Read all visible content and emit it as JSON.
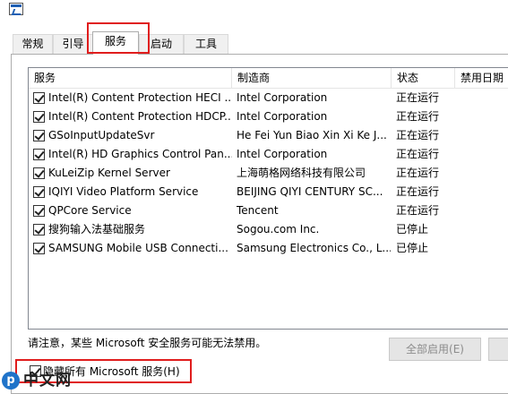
{
  "tabs": [
    {
      "label": "常规"
    },
    {
      "label": "引导"
    },
    {
      "label": "服务"
    },
    {
      "label": "启动"
    },
    {
      "label": "工具"
    }
  ],
  "active_tab": "服务",
  "columns": [
    "服务",
    "制造商",
    "状态",
    "禁用日期"
  ],
  "services": [
    {
      "name": "Intel(R) Content Protection HECI ...",
      "maker": "Intel Corporation",
      "status": "正在运行",
      "checked": true
    },
    {
      "name": "Intel(R) Content Protection HDCP...",
      "maker": "Intel Corporation",
      "status": "正在运行",
      "checked": true
    },
    {
      "name": "GSoInputUpdateSvr",
      "maker": "He Fei Yun Biao Xin Xi Ke J...",
      "status": "正在运行",
      "checked": true
    },
    {
      "name": "Intel(R) HD Graphics Control Pan...",
      "maker": "Intel Corporation",
      "status": "正在运行",
      "checked": true
    },
    {
      "name": "KuLeiZip Kernel Server",
      "maker": "上海萌格网络科技有限公司",
      "status": "正在运行",
      "checked": true
    },
    {
      "name": "IQIYI Video Platform Service",
      "maker": "BEIJING QIYI CENTURY SC...",
      "status": "正在运行",
      "checked": true
    },
    {
      "name": "QPCore Service",
      "maker": "Tencent",
      "status": "正在运行",
      "checked": true
    },
    {
      "name": "搜狗输入法基础服务",
      "maker": "Sogou.com Inc.",
      "status": "已停止",
      "checked": true
    },
    {
      "name": "SAMSUNG Mobile USB Connecti...",
      "maker": "Samsung Electronics Co., L...",
      "status": "已停止",
      "checked": true
    }
  ],
  "note": "请注意，某些 Microsoft 安全服务可能无法禁用。",
  "buttons": {
    "enable_all": "全部启用(E)"
  },
  "hide_microsoft": {
    "label": "隐藏所有 Microsoft 服务(H)",
    "checked": true
  },
  "watermark": {
    "logo_char": "php",
    "text": "中文网"
  },
  "colors": {
    "highlight": "#e01d1d",
    "disabled_text": "#8c8c8c"
  }
}
